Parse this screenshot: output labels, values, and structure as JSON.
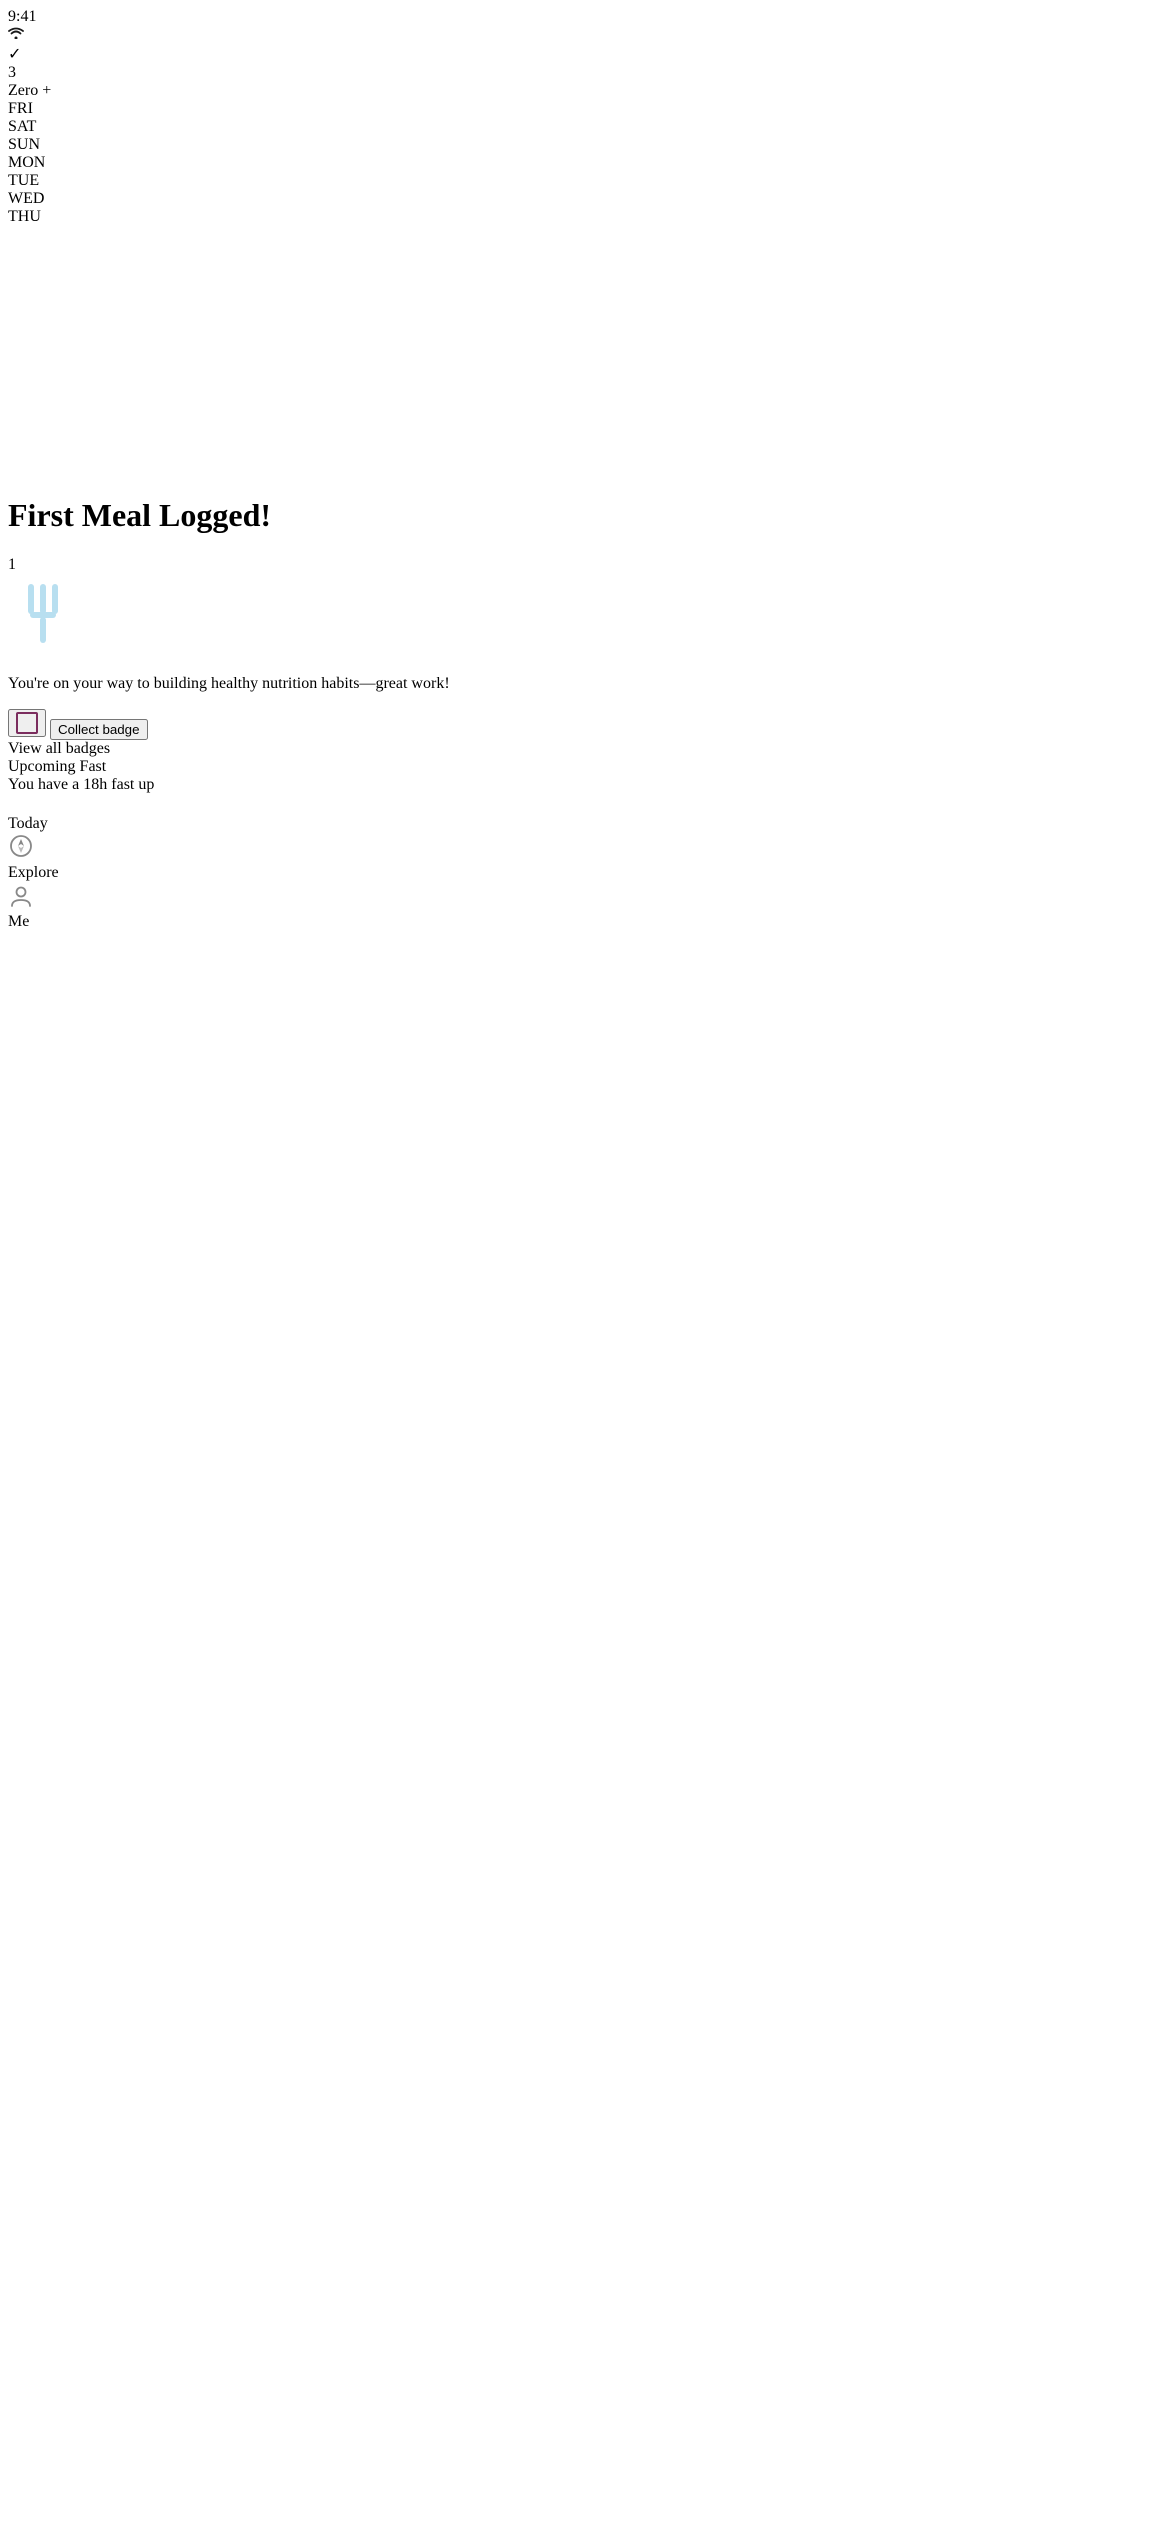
{
  "statusBar": {
    "time": "9:41",
    "batteryLevel": "full"
  },
  "header": {
    "badgeCount": "3",
    "appTitle": "Zero",
    "addButtonLabel": "+"
  },
  "calendar": {
    "days": [
      {
        "label": "FRI",
        "active": false
      },
      {
        "label": "SAT",
        "active": false
      },
      {
        "label": "SUN",
        "active": false
      },
      {
        "label": "MON",
        "active": false
      },
      {
        "label": "TUE",
        "active": false
      },
      {
        "label": "WED",
        "active": false
      },
      {
        "label": "THU",
        "active": true
      }
    ]
  },
  "modal": {
    "title": "First Meal Logged!",
    "badgeNumber": "1",
    "description": "You're on your way to building healthy nutrition habits—great work!",
    "collectButtonLabel": "Collect badge",
    "viewAllLabel": "View all badges"
  },
  "bottomSection": {
    "upcomingTitle": "Upcoming Fast",
    "upcomingSubtitle": "You have a 18h fast up"
  },
  "tabBar": {
    "tabs": [
      {
        "label": "Today",
        "active": true,
        "icon": "today"
      },
      {
        "label": "Explore",
        "active": false,
        "icon": "compass"
      },
      {
        "label": "Me",
        "active": false,
        "icon": "person"
      }
    ]
  },
  "icons": {
    "shareIcon": "↑",
    "checkIcon": "✓",
    "todayIcon": "●",
    "compassIcon": "◎",
    "personIcon": "○",
    "forkIcon": "⚐"
  }
}
